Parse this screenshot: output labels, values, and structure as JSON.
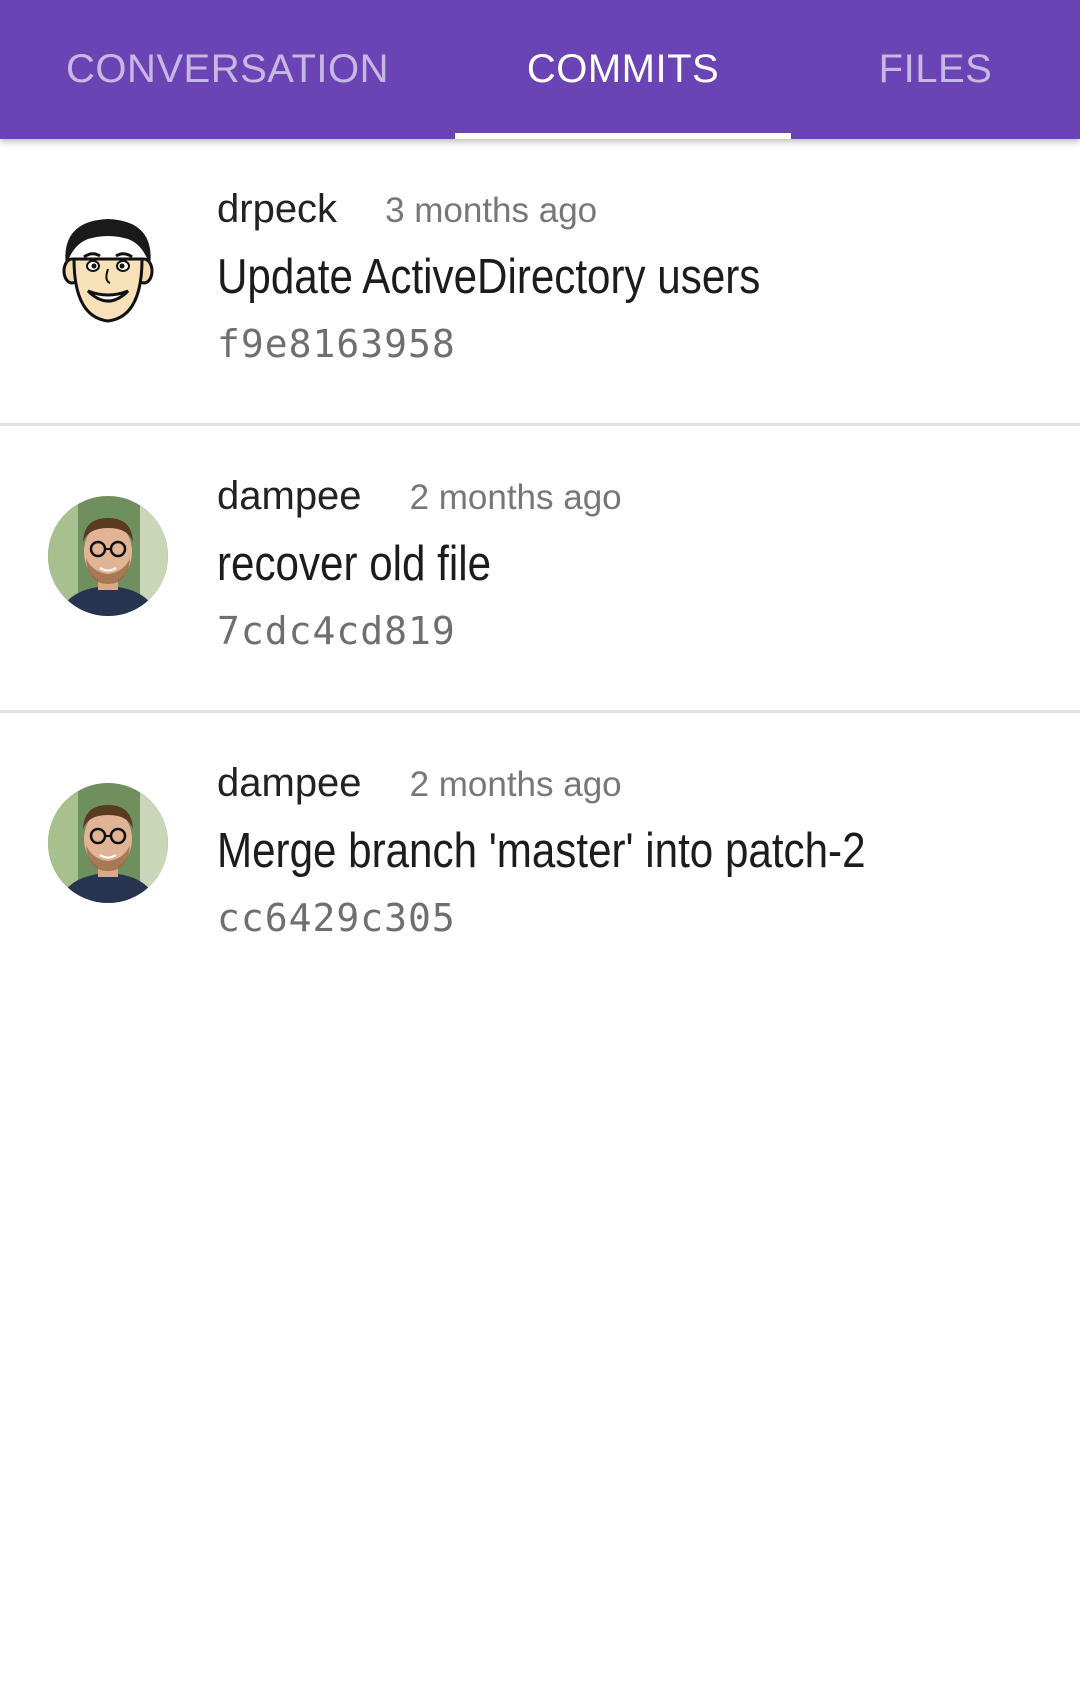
{
  "tabs": [
    {
      "label": "CONVERSATION",
      "active": false
    },
    {
      "label": "COMMITS",
      "active": true
    },
    {
      "label": "FILES",
      "active": false
    }
  ],
  "colors": {
    "tabbar": "#6a44b5",
    "indicator": "#ffffff"
  },
  "commits": [
    {
      "author": "drpeck",
      "time": "3 months ago",
      "message": "Update ActiveDirectory users",
      "sha": "f9e8163958",
      "avatar": "cartoon-face-avatar"
    },
    {
      "author": "dampee",
      "time": "2 months ago",
      "message": "recover old file",
      "sha": "7cdc4cd819",
      "avatar": "photo-avatar"
    },
    {
      "author": "dampee",
      "time": "2 months ago",
      "message": "Merge branch 'master' into patch-2",
      "sha": "cc6429c305",
      "avatar": "photo-avatar"
    }
  ]
}
